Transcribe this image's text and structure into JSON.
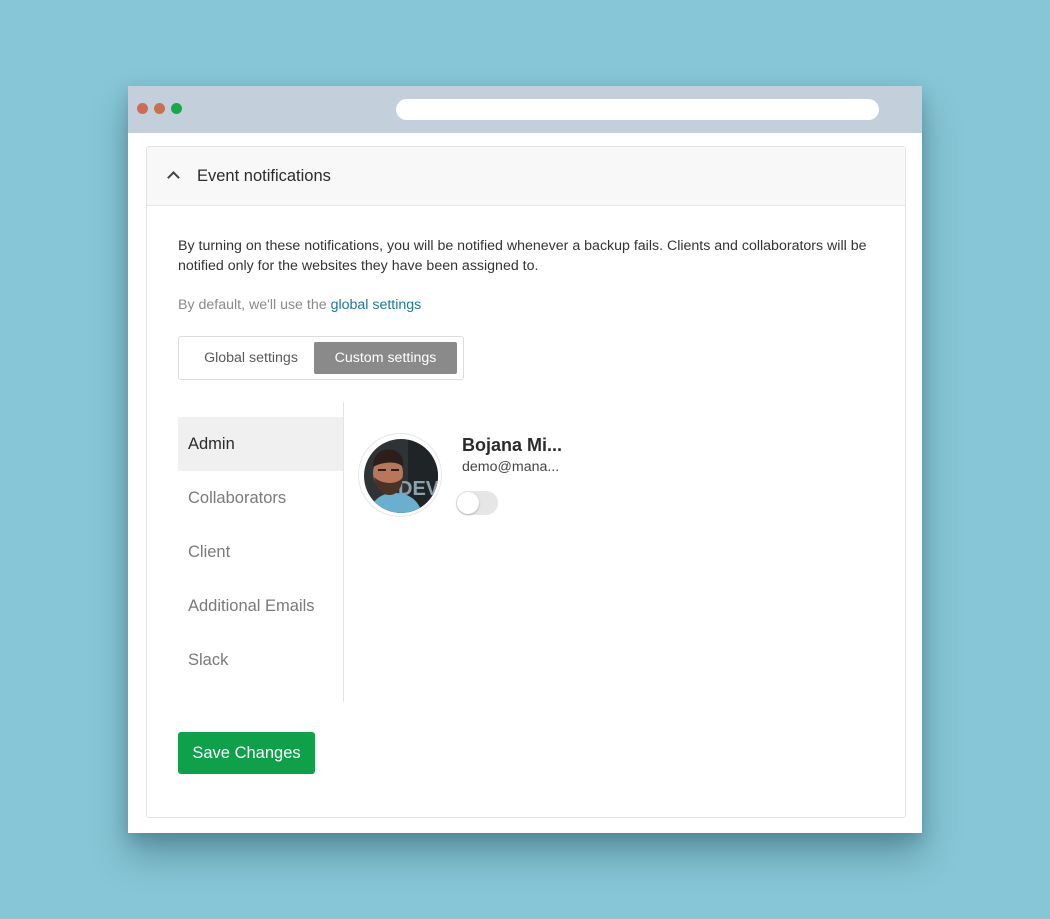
{
  "window": {
    "traffic_lights": [
      "red",
      "orange",
      "green"
    ],
    "url_value": ""
  },
  "panel": {
    "title": "Event notifications",
    "chevron_icon": "chevron-up-icon",
    "intro_text": "By turning on these notifications, you will be notified whenever a backup fails. Clients and collaborators will be notified only for the websites they have been assigned to.",
    "default_prefix": "By default, we'll use the",
    "default_link": "global settings"
  },
  "settings_mode": {
    "options": [
      "Global settings",
      "Custom settings"
    ],
    "selected": "Custom settings"
  },
  "sidebar": {
    "items": [
      {
        "label": "Admin",
        "active": true
      },
      {
        "label": "Collaborators",
        "active": false
      },
      {
        "label": "Client",
        "active": false
      },
      {
        "label": "Additional Emails",
        "active": false
      },
      {
        "label": "Slack",
        "active": false
      }
    ]
  },
  "user": {
    "name": "Bojana Mi...",
    "email": "demo@mana...",
    "notifications_enabled": false,
    "avatar_text": "DEV"
  },
  "actions": {
    "save_label": "Save Changes"
  },
  "colors": {
    "background": "#86c6d6",
    "titlebar": "#c3d0dc",
    "link": "#1f7a8c",
    "primary_button": "#0fa04a",
    "selected_segment": "#8a8a8a"
  }
}
